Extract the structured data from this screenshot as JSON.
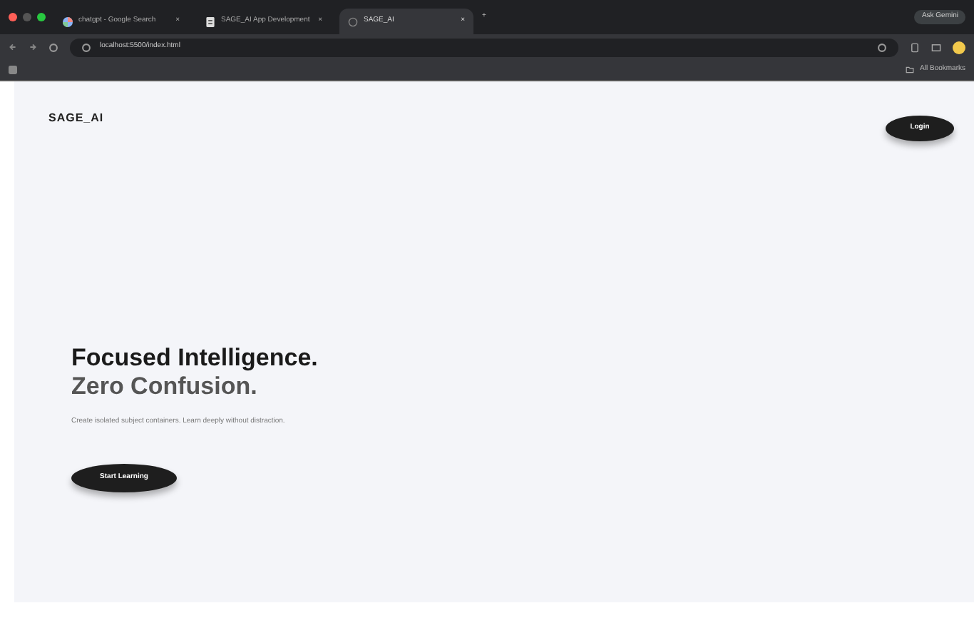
{
  "browser": {
    "tabs": [
      {
        "title": "chatgpt - Google Search",
        "selected": false,
        "kind": "google"
      },
      {
        "title": "SAGE_AI App Development",
        "selected": false,
        "kind": "doc"
      },
      {
        "title": "SAGE_AI",
        "selected": true,
        "kind": "globe"
      }
    ],
    "new_tab": "+",
    "close": "×",
    "address": "localhost:5500/index.html",
    "ask_button": "Ask Gemini",
    "bookmarks": "All Bookmarks"
  },
  "header": {
    "logo": "SAGE_AI",
    "login": "Login"
  },
  "hero": {
    "title_line_1": "Focused Intelligence.",
    "title_line_2": "Zero Confusion.",
    "subtitle": "Create isolated subject containers. Learn deeply without distraction.",
    "cta": "Start Learning"
  }
}
